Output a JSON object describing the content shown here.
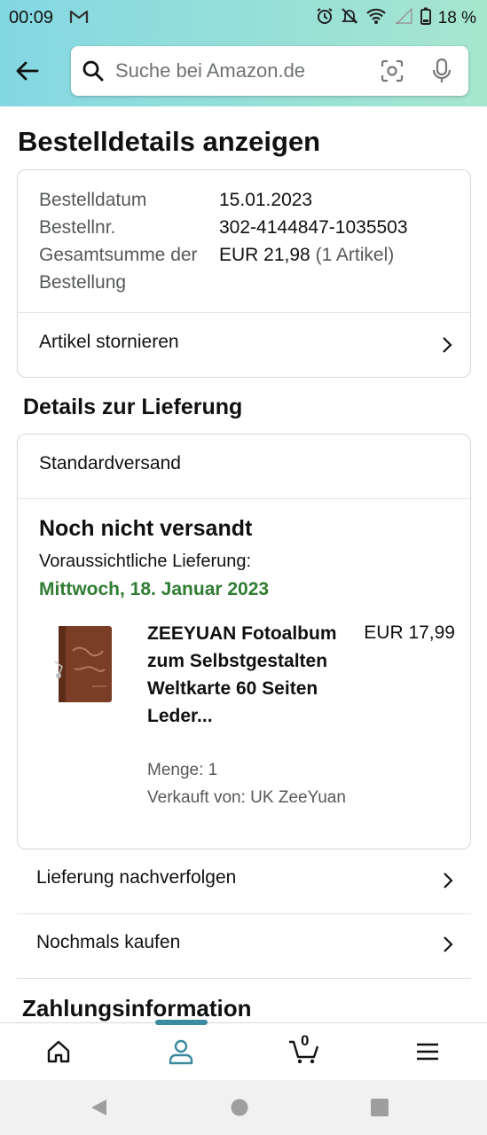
{
  "status_bar": {
    "time": "00:09",
    "battery": "18 %"
  },
  "search": {
    "placeholder": "Suche bei Amazon.de"
  },
  "page": {
    "title": "Bestelldetails anzeigen"
  },
  "order_summary": {
    "rows": [
      {
        "label": "Bestelldatum",
        "value": "15.01.2023"
      },
      {
        "label": "Bestellnr.",
        "value": "302-4144847-1035503"
      },
      {
        "label": "Gesamtsumme der Bestellung",
        "value": "EUR 21,98",
        "value_note": "(1 Artikel)"
      }
    ],
    "cancel_label": "Artikel stornieren"
  },
  "delivery": {
    "section_title": "Details zur Lieferung",
    "shipping_type": "Standardversand",
    "status": "Noch nicht versandt",
    "expected_label": "Voraussichtliche Lieferung:",
    "expected_date": "Mittwoch, 18. Januar 2023",
    "item": {
      "title": "ZEEYUAN Fotoalbum zum Selbstgestalten Weltkarte 60 Seiten Leder...",
      "price": "EUR 17,99",
      "quantity": "Menge: 1",
      "seller": "Verkauft von: UK ZeeYuan"
    }
  },
  "actions": {
    "track_label": "Lieferung nachverfolgen",
    "buy_again_label": "Nochmals kaufen"
  },
  "payment": {
    "section_title": "Zahlungsinformation"
  },
  "bottom_nav": {
    "cart_count": "0",
    "active": "account"
  },
  "colors": {
    "header_gradient_start": "#84d8e3",
    "header_gradient_end": "#a6e6ce",
    "delivery_green": "#2f7d32",
    "nav_accent": "#3a8aa0"
  }
}
